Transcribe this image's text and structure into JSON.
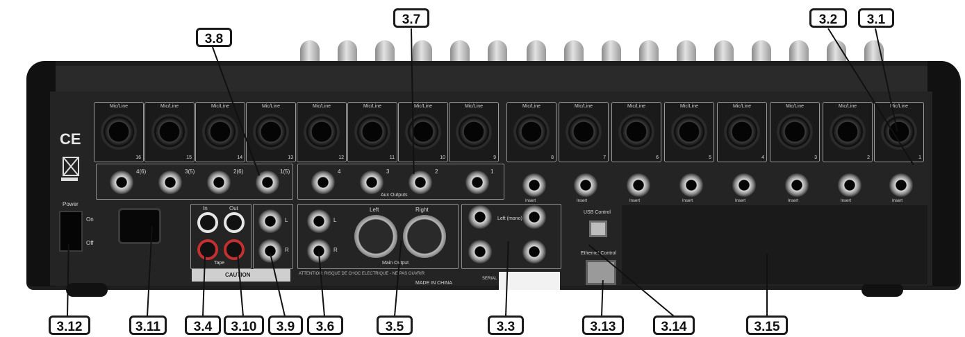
{
  "callouts": {
    "c3_1": "3.1",
    "c3_2": "3.2",
    "c3_3": "3.3",
    "c3_4": "3.4",
    "c3_5": "3.5",
    "c3_6": "3.6",
    "c3_7": "3.7",
    "c3_8": "3.8",
    "c3_9": "3.9",
    "c3_10": "3.10",
    "c3_11": "3.11",
    "c3_12": "3.12",
    "c3_13": "3.13",
    "c3_14": "3.14",
    "c3_15": "3.15"
  },
  "panel_text": {
    "ce_mark": "CE",
    "mic_line": "Mic/Line",
    "power": "Power",
    "on": "On",
    "off": "Off",
    "usb_control": "USB Control",
    "ethernet_control": "Ethernet Control",
    "left": "Left",
    "right": "Right",
    "left_mono": "Left (mono)",
    "main_output": "Main Output",
    "aux_outputs": "Aux Outputs",
    "insert": "Insert",
    "made_in_china": "MADE IN CHINA",
    "serial": "SERIAL",
    "caution": "CAUTION",
    "l": "L",
    "r": "R",
    "in": "In",
    "out": "Out",
    "tape": "Tape",
    "attention": "ATTENTION: RISQUE DE CHOC ELECTRIQUE - NE PAS OUVRIR"
  },
  "channels": [
    "16",
    "15",
    "14",
    "13",
    "12",
    "11",
    "10",
    "9",
    "8",
    "7",
    "6",
    "5",
    "4",
    "3",
    "2",
    "1"
  ],
  "aux_labels": [
    "4(6)",
    "3(5)",
    "2(6)",
    "1(5)",
    "4",
    "3",
    "2",
    "1"
  ],
  "colors": {
    "chassis": "#1d1d1d",
    "callout_border": "#1a1a1a",
    "rca_red": "#c43030"
  }
}
